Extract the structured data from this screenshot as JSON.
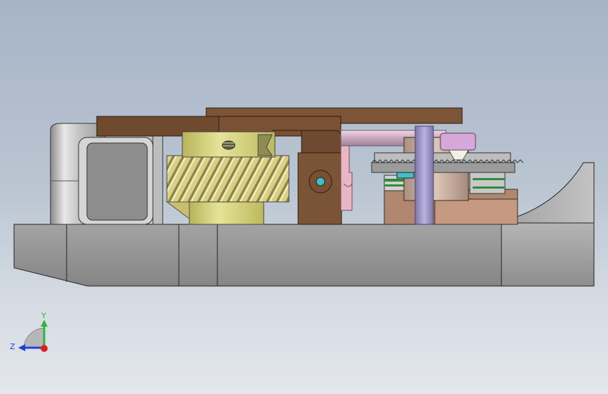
{
  "triad": {
    "y_label": "Y",
    "z_label": "Z",
    "y_color": "#2db83a",
    "z_color": "#1f3fd6",
    "x_color": "#e02020"
  },
  "colors": {
    "base_plate": "#9e9e9e",
    "bracket": "#7a5235",
    "helical_gear": "#d8cf7e",
    "gear_hub": "#cfcf6e",
    "pink_part": "#e4b3c0",
    "shaft": "#9a92c2",
    "spur_gear": "#a8a8a8",
    "housing": "#c9c9c9",
    "curved_plate": "#b4b4b4"
  }
}
